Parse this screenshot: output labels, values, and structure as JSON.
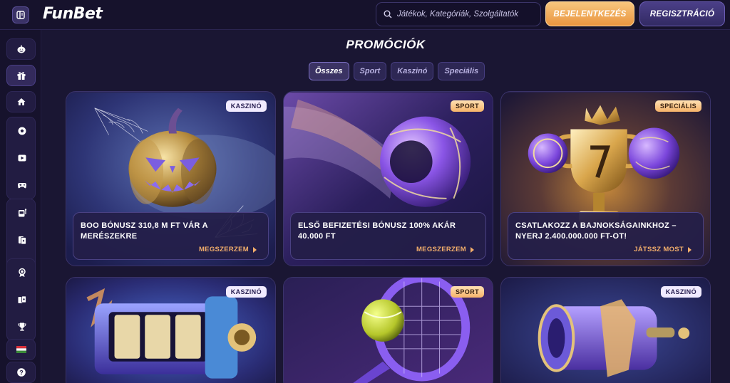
{
  "header": {
    "logo": "FunBet",
    "search_placeholder": "Játékok, Kategóriák, Szolgáltatók",
    "login_label": "BEJELENTKEZÉS",
    "register_label": "REGISZTRÁCIÓ"
  },
  "sidebar": {
    "icons": [
      "pumpkin-icon",
      "gift-icon",
      "home-icon",
      "sports-ball-icon",
      "play-icon",
      "gamepad-icon",
      "slot-machine-icon",
      "cards-icon",
      "clover-icon",
      "medal-icon",
      "playing-cards-icon",
      "trophy-icon"
    ],
    "language_flag": "hungary-flag-icon",
    "help": "?"
  },
  "page": {
    "title": "PROMÓCIÓK",
    "tabs": [
      {
        "label": "Összes",
        "active": true
      },
      {
        "label": "Sport",
        "active": false
      },
      {
        "label": "Kaszinó",
        "active": false
      },
      {
        "label": "Speciális",
        "active": false
      }
    ]
  },
  "cards": [
    {
      "badge": "KASZINÓ",
      "title": "BOO BÓNUSZ 310,8 M FT VÁR A MERÉSZEKRE",
      "cta": "MEGSZERZEM",
      "art": "pumpkin"
    },
    {
      "badge": "SPORT",
      "title": "ELSŐ BEFIZETÉSI BÓNUSZ 100% AKÁR 40.000 FT",
      "cta": "MEGSZERZEM",
      "art": "ball"
    },
    {
      "badge": "SPECIÁLIS",
      "title": "CSATLAKOZZ A BAJNOKSÁGAINKHOZ – NYERJ 2.400.000.000 FT-OT!",
      "cta": "JÁTSSZ MOST",
      "art": "trophy"
    },
    {
      "badge": "KASZINÓ",
      "art": "slot"
    },
    {
      "badge": "SPORT",
      "art": "tennis"
    },
    {
      "badge": "KASZINÓ",
      "art": "barrel"
    }
  ],
  "colors": {
    "background": "#1a1633",
    "accent_orange": "#f2ae6b",
    "card_panel": "#241e48",
    "badge_light": "#f1ebff"
  }
}
